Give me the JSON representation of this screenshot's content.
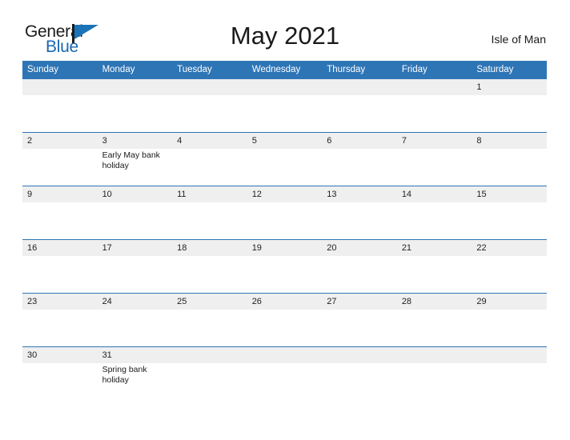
{
  "header": {
    "logo": {
      "text_primary": "General",
      "text_secondary": "Blue",
      "color_primary": "#1b1b1b",
      "color_secondary": "#1769b0",
      "flag_color": "#1b73b8"
    },
    "title": "May 2021",
    "region": "Isle of Man"
  },
  "calendar": {
    "accent_color": "#2e75b6",
    "number_band_color": "#efefef",
    "weekdays": [
      "Sunday",
      "Monday",
      "Tuesday",
      "Wednesday",
      "Thursday",
      "Friday",
      "Saturday"
    ],
    "weeks": [
      {
        "days": [
          {
            "number": "",
            "event": ""
          },
          {
            "number": "",
            "event": ""
          },
          {
            "number": "",
            "event": ""
          },
          {
            "number": "",
            "event": ""
          },
          {
            "number": "",
            "event": ""
          },
          {
            "number": "",
            "event": ""
          },
          {
            "number": "1",
            "event": ""
          }
        ]
      },
      {
        "days": [
          {
            "number": "2",
            "event": ""
          },
          {
            "number": "3",
            "event": "Early May bank holiday"
          },
          {
            "number": "4",
            "event": ""
          },
          {
            "number": "5",
            "event": ""
          },
          {
            "number": "6",
            "event": ""
          },
          {
            "number": "7",
            "event": ""
          },
          {
            "number": "8",
            "event": ""
          }
        ]
      },
      {
        "days": [
          {
            "number": "9",
            "event": ""
          },
          {
            "number": "10",
            "event": ""
          },
          {
            "number": "11",
            "event": ""
          },
          {
            "number": "12",
            "event": ""
          },
          {
            "number": "13",
            "event": ""
          },
          {
            "number": "14",
            "event": ""
          },
          {
            "number": "15",
            "event": ""
          }
        ]
      },
      {
        "days": [
          {
            "number": "16",
            "event": ""
          },
          {
            "number": "17",
            "event": ""
          },
          {
            "number": "18",
            "event": ""
          },
          {
            "number": "19",
            "event": ""
          },
          {
            "number": "20",
            "event": ""
          },
          {
            "number": "21",
            "event": ""
          },
          {
            "number": "22",
            "event": ""
          }
        ]
      },
      {
        "days": [
          {
            "number": "23",
            "event": ""
          },
          {
            "number": "24",
            "event": ""
          },
          {
            "number": "25",
            "event": ""
          },
          {
            "number": "26",
            "event": ""
          },
          {
            "number": "27",
            "event": ""
          },
          {
            "number": "28",
            "event": ""
          },
          {
            "number": "29",
            "event": ""
          }
        ]
      },
      {
        "days": [
          {
            "number": "30",
            "event": ""
          },
          {
            "number": "31",
            "event": "Spring bank holiday"
          },
          {
            "number": "",
            "event": ""
          },
          {
            "number": "",
            "event": ""
          },
          {
            "number": "",
            "event": ""
          },
          {
            "number": "",
            "event": ""
          },
          {
            "number": "",
            "event": ""
          }
        ]
      }
    ]
  }
}
